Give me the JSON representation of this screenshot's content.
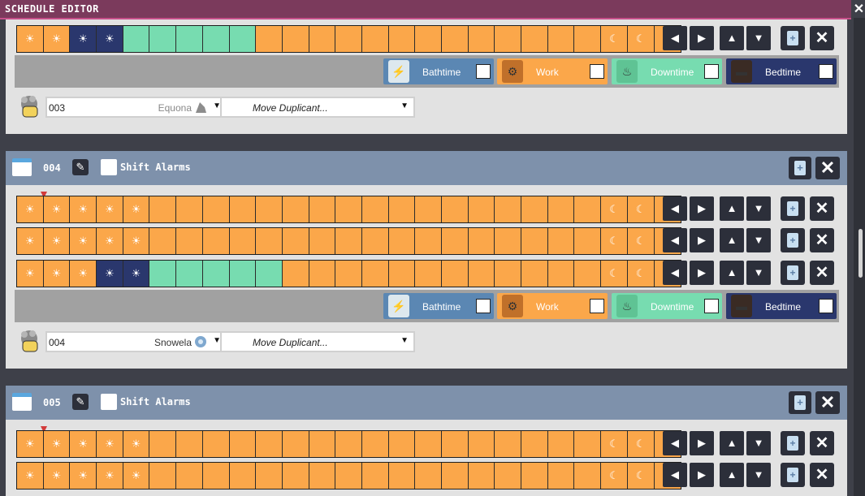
{
  "window": {
    "title": "SCHEDULE EDITOR",
    "close_icon": "close-icon"
  },
  "blocks": {
    "icons": {
      "hygiene": "☀",
      "bedtime": "☀",
      "downtime": "",
      "work": "",
      "sleep": "☾"
    },
    "colors": {
      "work": "#fba74a",
      "bedtime": "#2a376d",
      "downtime": "#77dcb0"
    }
  },
  "paint": {
    "bathtime": {
      "label": "Bathtime",
      "color": "#5b87b3"
    },
    "work": {
      "label": "Work",
      "color": "#fba74a"
    },
    "downtime": {
      "label": "Downtime",
      "color": "#77dcb0"
    },
    "bedtime": {
      "label": "Bedtime",
      "color": "#2a376d"
    }
  },
  "move_label": "Move Duplicant...",
  "schedules": [
    {
      "id": "003",
      "duplicant_num": "003",
      "duplicant_name": "Equona",
      "rows": [
        [
          "hyg",
          "hyg",
          "bed",
          "bed",
          "down",
          "down",
          "down",
          "down",
          "down",
          "work",
          "work",
          "work",
          "work",
          "work",
          "work",
          "work",
          "work",
          "work",
          "work",
          "work",
          "work",
          "work",
          "sleep",
          "sleep",
          "sleep"
        ]
      ]
    },
    {
      "id": "004",
      "name": "004",
      "shift_alarms": "Shift Alarms",
      "duplicant_num": "004",
      "duplicant_name": "Snowela",
      "rows": [
        [
          "hyg",
          "hyg",
          "hyg",
          "hyg",
          "hyg",
          "work",
          "work",
          "work",
          "work",
          "work",
          "work",
          "work",
          "work",
          "work",
          "work",
          "work",
          "work",
          "work",
          "work",
          "work",
          "work",
          "work",
          "sleep",
          "sleep",
          "sleep"
        ],
        [
          "hyg",
          "hyg",
          "hyg",
          "hyg",
          "hyg",
          "work",
          "work",
          "work",
          "work",
          "work",
          "work",
          "work",
          "work",
          "work",
          "work",
          "work",
          "work",
          "work",
          "work",
          "work",
          "work",
          "work",
          "sleep",
          "sleep",
          "sleep"
        ],
        [
          "hyg",
          "hyg",
          "hyg",
          "bed",
          "bed",
          "down",
          "down",
          "down",
          "down",
          "down",
          "work",
          "work",
          "work",
          "work",
          "work",
          "work",
          "work",
          "work",
          "work",
          "work",
          "work",
          "work",
          "sleep",
          "sleep",
          "sleep"
        ]
      ]
    },
    {
      "id": "005",
      "name": "005",
      "shift_alarms": "Shift Alarms",
      "rows": [
        [
          "hyg",
          "hyg",
          "hyg",
          "hyg",
          "hyg",
          "work",
          "work",
          "work",
          "work",
          "work",
          "work",
          "work",
          "work",
          "work",
          "work",
          "work",
          "work",
          "work",
          "work",
          "work",
          "work",
          "work",
          "sleep",
          "sleep",
          "sleep"
        ],
        [
          "hyg",
          "hyg",
          "hyg",
          "hyg",
          "hyg",
          "work",
          "work",
          "work",
          "work",
          "work",
          "work",
          "work",
          "work",
          "work",
          "work",
          "work",
          "work",
          "work",
          "work",
          "work",
          "work",
          "work",
          "sleep",
          "sleep",
          "sleep"
        ]
      ]
    }
  ]
}
